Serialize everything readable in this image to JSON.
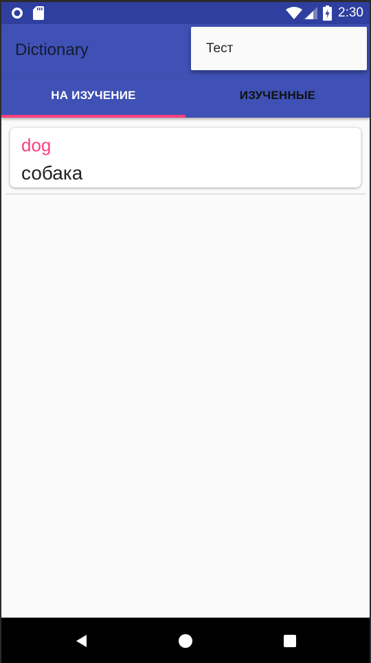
{
  "status_bar": {
    "time": "2:30",
    "icons": [
      "circle-notification-icon",
      "sd-card-icon",
      "wifi-icon",
      "cell-signal-icon",
      "battery-charging-icon"
    ]
  },
  "app_bar": {
    "title": "Dictionary"
  },
  "popup_menu": {
    "items": [
      {
        "label": "Тест"
      }
    ]
  },
  "tabs": [
    {
      "label": "НА ИЗУЧЕНИЕ",
      "selected": true
    },
    {
      "label": "ИЗУЧЕННЫЕ",
      "selected": false
    }
  ],
  "words": [
    {
      "word": "dog",
      "translation": "собака"
    }
  ],
  "nav_bar": {
    "icons": [
      "back-icon",
      "home-icon",
      "recents-icon"
    ]
  },
  "colors": {
    "primary": "#3f51b5",
    "primary_dark": "#2f3f9f",
    "accent": "#ff4081",
    "background": "#fafafa"
  }
}
